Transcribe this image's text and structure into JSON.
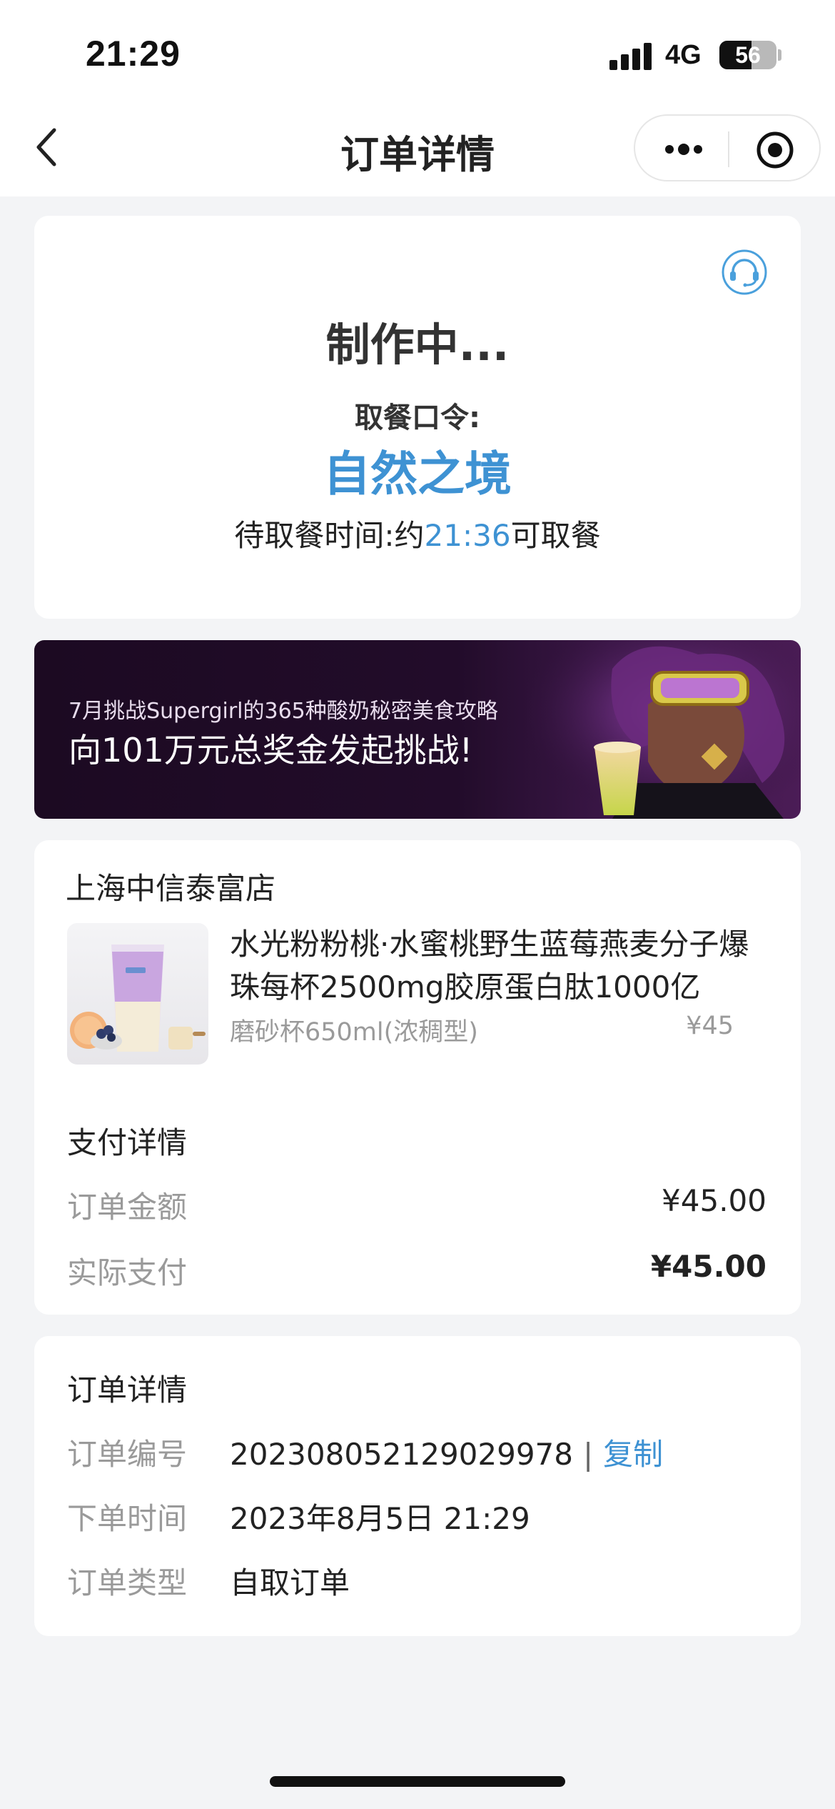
{
  "status_bar": {
    "time": "21:29",
    "network": "4G",
    "battery_percent": 56,
    "battery_label": "56"
  },
  "nav": {
    "title": "订单详情",
    "back_icon": "chevron-left-icon",
    "more_icon": "more-dots-icon",
    "close_icon": "target-circle-icon"
  },
  "status_card": {
    "status": "制作中...",
    "pickup_code_label": "取餐口令:",
    "pickup_code": "自然之境",
    "wait_prefix": "待取餐时间:约",
    "wait_time": "21:36",
    "wait_suffix": "可取餐",
    "service_icon": "headset-icon"
  },
  "banner": {
    "line1": "7月挑战Supergirl的365种酸奶秘密美食攻略",
    "line2": "向101万元总奖金发起挑战!"
  },
  "order_card": {
    "store_name": "上海中信泰富店",
    "product": {
      "name": "水光粉粉桃·水蜜桃野生蓝莓燕麦分子爆珠每杯2500mg胶原蛋白肽1000亿",
      "spec": "磨砂杯650ml(浓稠型)",
      "price": "¥45"
    },
    "payment": {
      "title": "支付详情",
      "rows": [
        {
          "label": "订单金额",
          "value": "¥45.00"
        },
        {
          "label": "实际支付",
          "value": "¥45.00"
        }
      ]
    }
  },
  "details_card": {
    "title": "订单详情",
    "rows": [
      {
        "label": "订单编号",
        "value": "202308052129029978"
      },
      {
        "label": "下单时间",
        "value": "2023年8月5日 21:29"
      },
      {
        "label": "订单类型",
        "value": "自取订单"
      }
    ],
    "separator": "|",
    "copy_label": "复制"
  },
  "colors": {
    "accent": "#3e92d3",
    "background": "#f3f4f6",
    "muted_text": "#9a9a9a"
  }
}
